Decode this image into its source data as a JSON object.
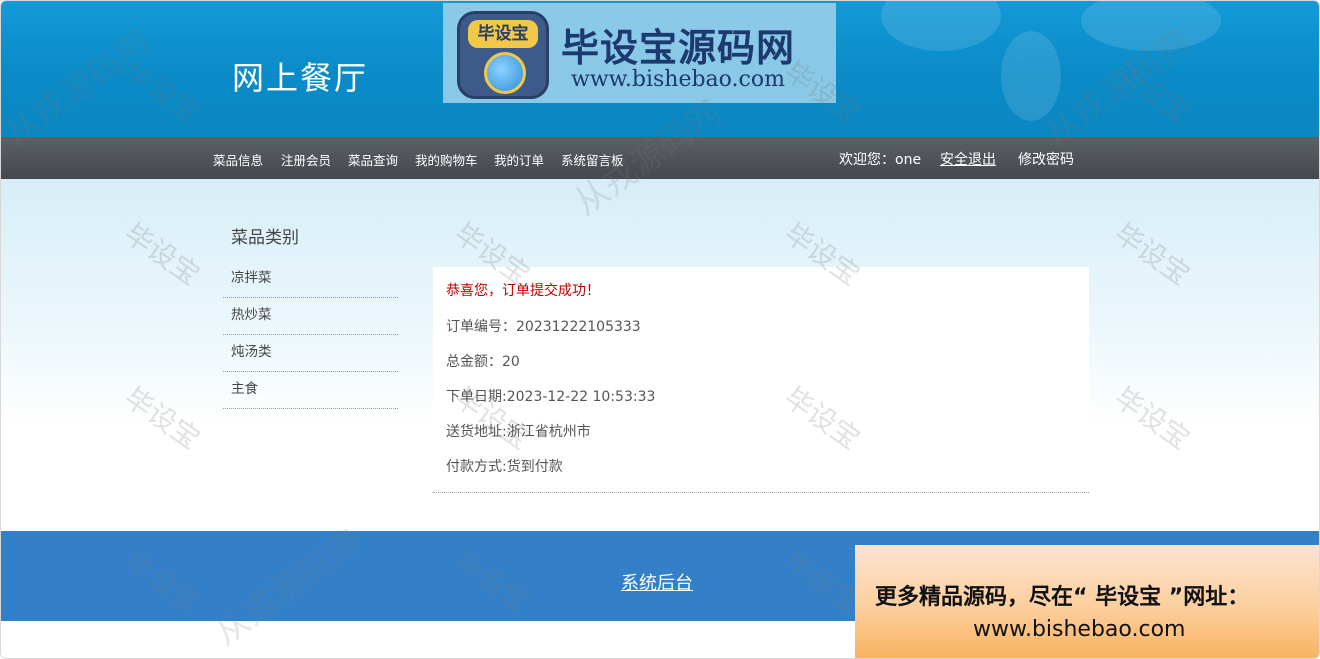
{
  "header": {
    "site_title": "网上餐厅",
    "logo_badge": "毕设宝",
    "logo_text": "毕设宝源码网",
    "logo_url": "www.bishebao.com"
  },
  "nav": {
    "items": [
      "菜品信息",
      "注册会员",
      "菜品查询",
      "我的购物车",
      "我的订单",
      "系统留言板"
    ],
    "welcome_label": "欢迎您：one",
    "logout": "安全退出",
    "change_password": "修改密码"
  },
  "sidebar": {
    "title": "菜品类别",
    "categories": [
      "凉拌菜",
      "热炒菜",
      "炖汤类",
      "主食"
    ]
  },
  "order": {
    "success_message": "恭喜您，订单提交成功！",
    "order_no": "订单编号：20231222105333",
    "total": "总金额：20",
    "order_date": "下单日期:2023-12-22 10:53:33",
    "address": "送货地址:浙江省杭州市",
    "payment": "付款方式:货到付款"
  },
  "footer": {
    "admin_link": "系统后台"
  },
  "ad": {
    "line1": "更多精品源码，尽在“ 毕设宝 ”网址：",
    "line2": "www.bishebao.com"
  },
  "watermarks": {
    "short": "毕设宝",
    "long": "从戎源码网"
  },
  "colors": {
    "header_blue": "#0b8dcb",
    "nav_dark": "#4e5258",
    "footer_blue": "#3380c9",
    "success_red": "#c00000"
  }
}
